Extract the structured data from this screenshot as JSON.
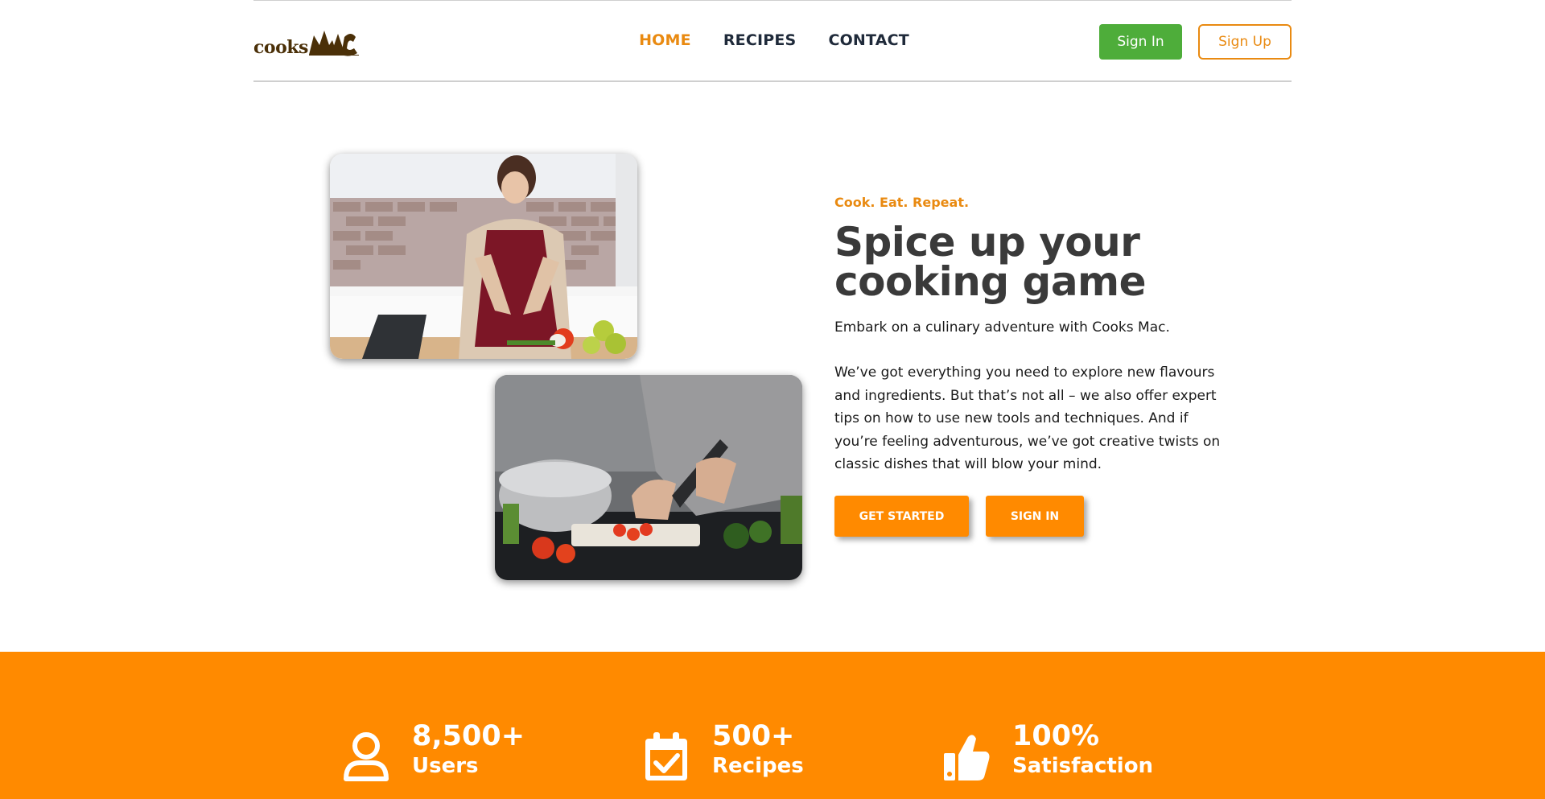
{
  "brand": {
    "logo_text": "cooks",
    "logo_mark_text": "MAC"
  },
  "nav": {
    "items": [
      {
        "label": "HOME",
        "active": true
      },
      {
        "label": "RECIPES",
        "active": false
      },
      {
        "label": "CONTACT",
        "active": false
      }
    ]
  },
  "auth": {
    "sign_in": "Sign In",
    "sign_up": "Sign Up"
  },
  "hero": {
    "tagline": "Cook. Eat. Repeat.",
    "headline_line1": "Spice up your",
    "headline_line2": "cooking game",
    "lead": "Embark on a culinary adventure with Cooks Mac.",
    "body": "We’ve got everything you need to explore new flavours and ingredients. But that’s not all – we also offer expert tips on how to use new tools and techniques. And if you’re feeling adventurous, we’ve got creative twists on classic dishes that will blow your mind.",
    "cta_primary": "GET STARTED",
    "cta_secondary": "SIGN IN"
  },
  "stats": [
    {
      "value": "8,500+",
      "label": "Users",
      "icon": "user-icon"
    },
    {
      "value": "500+",
      "label": "Recipes",
      "icon": "calendar-check-icon"
    },
    {
      "value": "100%",
      "label": "Satisfaction",
      "icon": "thumbs-up-icon"
    }
  ],
  "colors": {
    "accent": "#ff8a00",
    "accent_text": "#e98a11",
    "sign_in_green": "#4ead3a",
    "heading": "#3a3a3a",
    "nav_text": "#1f2a3a",
    "logo_brown": "#4b3008"
  }
}
